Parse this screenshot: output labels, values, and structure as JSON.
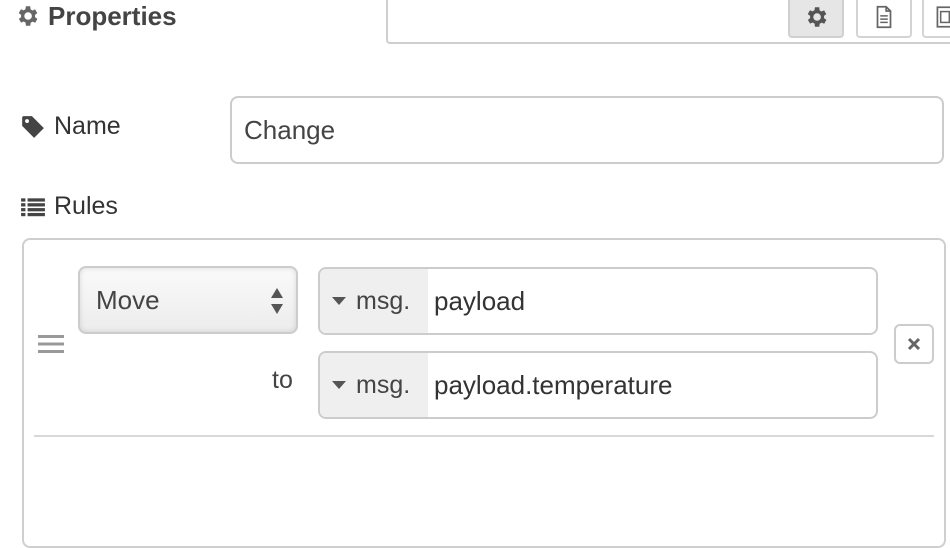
{
  "header": {
    "title": "Properties",
    "icon": "gear-icon",
    "tabs": [
      {
        "name": "node-properties",
        "icon": "gear-icon",
        "active": true
      },
      {
        "name": "description",
        "icon": "document-icon",
        "active": false
      },
      {
        "name": "appearance",
        "icon": "frame-icon",
        "active": false
      }
    ]
  },
  "name_field": {
    "label": "Name",
    "icon": "tag-icon",
    "value": "Change"
  },
  "rules": {
    "label": "Rules",
    "icon": "list-icon",
    "items": [
      {
        "action": "Move",
        "from": {
          "type": "msg.",
          "value": "payload"
        },
        "to_label": "to",
        "to": {
          "type": "msg.",
          "value": "payload.temperature"
        }
      }
    ]
  }
}
